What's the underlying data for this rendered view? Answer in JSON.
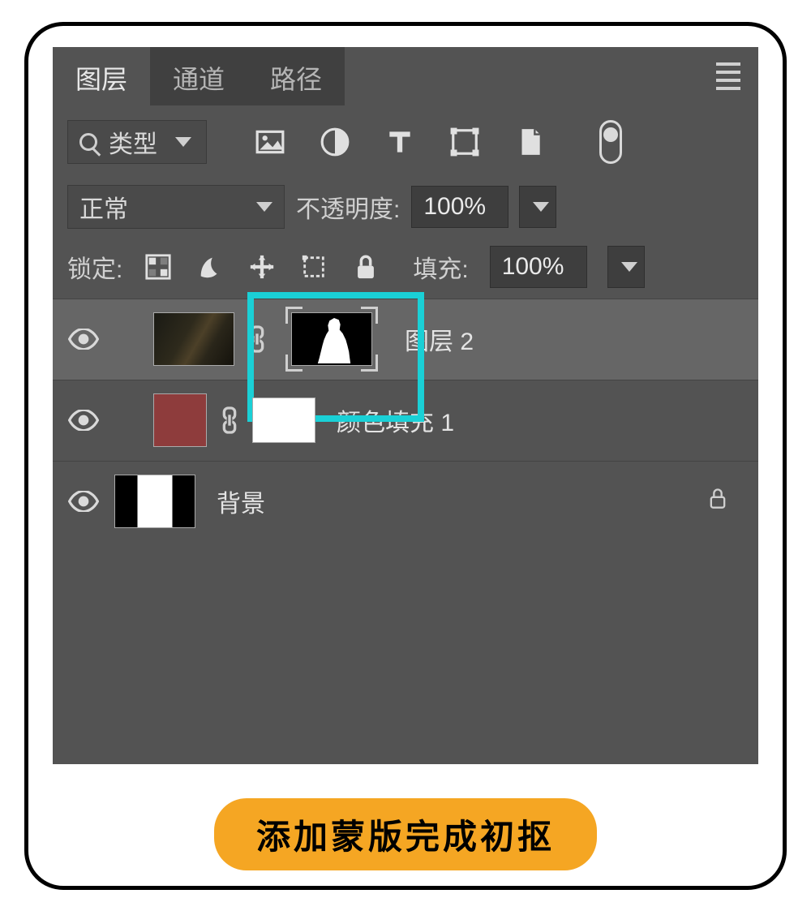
{
  "tabs": {
    "layers": "图层",
    "channels": "通道",
    "paths": "路径"
  },
  "filter": {
    "kind_label": "类型"
  },
  "blend": {
    "mode": "正常",
    "opacity_label": "不透明度:",
    "opacity_value": "100%"
  },
  "lock": {
    "label": "锁定:",
    "fill_label": "填充:",
    "fill_value": "100%"
  },
  "layers": [
    {
      "name": "图层 2"
    },
    {
      "name": "颜色填充 1"
    },
    {
      "name": "背景"
    }
  ],
  "caption": "添加蒙版完成初抠"
}
